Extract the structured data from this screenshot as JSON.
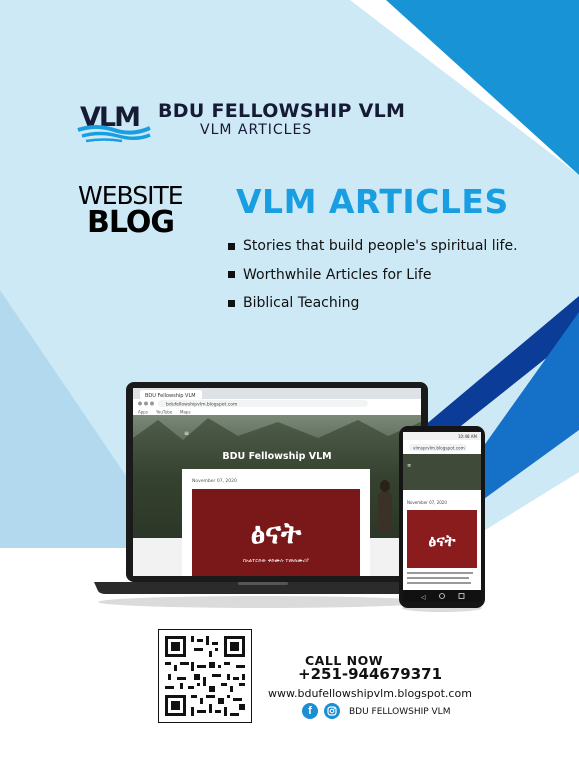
{
  "brand": {
    "logo_text": "VLM",
    "name": "BDU FELLOWSHIP VLM",
    "subtitle": "VLM  ARTICLES"
  },
  "label": {
    "line1": "WEBSITE",
    "line2": "BLOG"
  },
  "headline": "VLM ARTICLES",
  "bullets": [
    "Stories that build people's spiritual life.",
    "Worthwhile Articles for Life",
    "Biblical Teaching"
  ],
  "laptop": {
    "tab_title": "BDU Fellowship VLM",
    "url": "bdufellowshipvlm.blogspot.com",
    "bookmarks": [
      "Apps",
      "YouTube",
      "Maps"
    ],
    "blog_title": "BDU Fellowship VLM",
    "post_date": "November 07, 2020",
    "post_image_title": "ፅናት",
    "post_image_sub": "ከአልተርድው ቅድሙሉ ተመጠሙሪያ"
  },
  "phone": {
    "status_time": "10:48 AM",
    "url": "vlmsprvlm.blogspot.com",
    "post_date": "November 07, 2020",
    "post_image_title": "ፅናት"
  },
  "contact": {
    "call_label": "CALL NOW",
    "phone": "+251-944679371",
    "website": "www.bdufellowshipvlm.blogspot.com",
    "social_name": "BDU FELLOWSHIP VLM"
  },
  "colors": {
    "accent": "#1a9ee2",
    "light_bg": "#cde9f6",
    "dark_blue": "#0d3e9c",
    "brand_dark": "#151a35"
  },
  "icons": [
    "facebook-icon",
    "instagram-icon",
    "qr-code"
  ]
}
